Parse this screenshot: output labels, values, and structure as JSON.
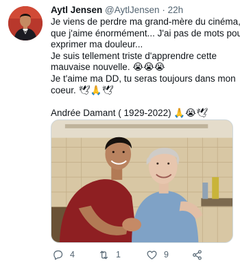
{
  "tweet": {
    "display_name": "Aytl Jensen",
    "handle": "@AytlJensen",
    "separator": "·",
    "time": "22h",
    "lines": [
      "Je viens de perdre ma grand-mère du cinéma,",
      "que j'aime énormément... J'ai pas de mots pour",
      "exprimer ma douleur...",
      "Je suis tellement triste d'apprendre cette",
      "mauvaise nouvelle. 😭😭😭",
      "Je t'aime ma DD, tu seras toujours dans mon",
      "coeur. 🕊🙏🕊",
      "Andrée Damant ( 1929-2022) 🙏😭🕊"
    ]
  },
  "actions": {
    "reply": {
      "icon": "reply-icon",
      "count": "4"
    },
    "retweet": {
      "icon": "retweet-icon",
      "count": "1"
    },
    "like": {
      "icon": "heart-icon",
      "count": "9"
    },
    "share": {
      "icon": "share-icon"
    }
  },
  "colors": {
    "text": "#0f1419",
    "secondary": "#536471",
    "border": "#cfd9de"
  }
}
